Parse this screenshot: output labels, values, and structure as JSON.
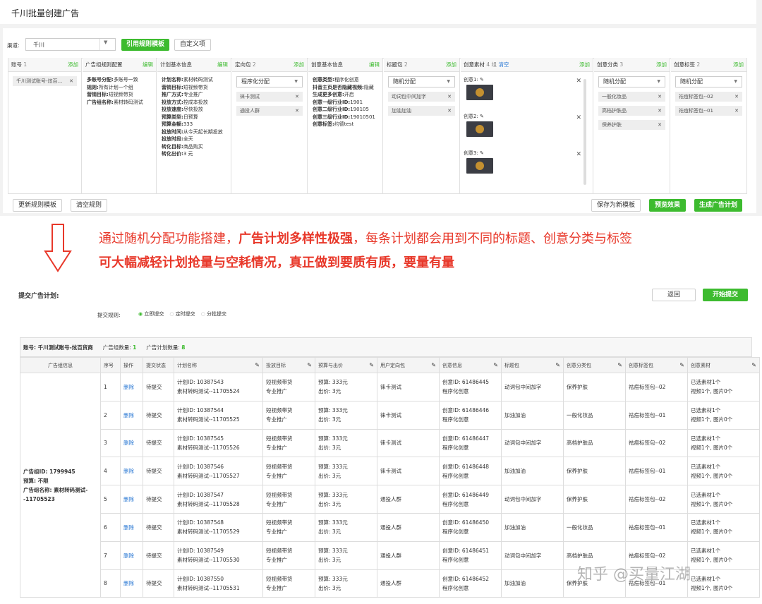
{
  "page_title": "千川批量创建广告",
  "channel": {
    "label": "渠道:",
    "value": "千川",
    "btn_template": "引用规则模板",
    "btn_custom": "自定义项"
  },
  "columns": {
    "account": {
      "title": "账号",
      "count": "1",
      "add": "添加",
      "tag": "千川测试账号-炫百…"
    },
    "group_rule": {
      "title": "广告组规则配置",
      "edit": "编辑",
      "lines": [
        [
          "多账号分配:",
          "多账号一致"
        ],
        [
          "规则:",
          "所有计划一个组"
        ],
        [
          "营销目标:",
          "短视频带货"
        ],
        [
          "广告组名称:",
          "素材转码测试"
        ]
      ]
    },
    "plan_info": {
      "title": "计划基本信息",
      "edit": "编辑",
      "lines": [
        [
          "计划名称:",
          "素材转码测试"
        ],
        [
          "营销目标:",
          "短视频带货"
        ],
        [
          "推广方式:",
          "专业推广"
        ],
        [
          "投放方式:",
          "控成本投放"
        ],
        [
          "投放速度:",
          "尽快投放"
        ],
        [
          "预算类型:",
          "日预算"
        ],
        [
          "预算金额:",
          "333"
        ],
        [
          "投放时间:",
          "从今天起长期投放"
        ],
        [
          "投放时段:",
          "全天"
        ],
        [
          "转化目标:",
          "商品购买"
        ],
        [
          "转化出价:",
          "3 元"
        ]
      ]
    },
    "audience": {
      "title": "定向包",
      "count": "2",
      "add": "添加",
      "select": "程序化分配",
      "tags": [
        "徕卡测试",
        "通投人群"
      ]
    },
    "creative_info": {
      "title": "创意基本信息",
      "edit": "编辑",
      "lines": [
        [
          "创意类型:",
          "程序化创意"
        ],
        [
          "抖音主页是否隐藏视频:",
          "隐藏"
        ],
        [
          "生成更多创意:",
          "开启"
        ],
        [
          "创意一级行业ID:",
          "1901"
        ],
        [
          "创意二级行业ID:",
          "190105"
        ],
        [
          "创意三级行业ID:",
          "19010501"
        ],
        [
          "创意标签:",
          "约德test"
        ]
      ]
    },
    "titles": {
      "title": "标题包",
      "count": "2",
      "add": "添加",
      "select": "随机分配",
      "tags": [
        "动词包中间加字",
        "加油加油"
      ]
    },
    "materials": {
      "title": "创意素材",
      "count": "4 组",
      "clear": "清空",
      "add": "添加",
      "items": [
        "创意1:",
        "创意2:",
        "创意3:"
      ]
    },
    "categories": {
      "title": "创意分类",
      "count": "3",
      "add": "添加",
      "select": "随机分配",
      "tags": [
        "一般化妆品",
        "高档护肤品",
        "保养护肤"
      ]
    },
    "labels": {
      "title": "创意标签",
      "count": "2",
      "add": "添加",
      "select": "随机分配",
      "tags": [
        "祛痘标签包--02",
        "祛痘标签包--01"
      ]
    }
  },
  "footer": {
    "update": "更新规则模板",
    "clear": "清空规则",
    "save": "保存为新模板",
    "preview": "预览效果",
    "generate": "生成广告计划"
  },
  "annotation": {
    "line1a": "通过随机分配功能搭建，",
    "line1b": "广告计划多样性极强",
    "line1c": "，每条计划都会用到不同的标题、创意分类与标签",
    "line2": "可大幅减轻计划抢量与空耗情况，真正做到要质有质，要量有量"
  },
  "submit": {
    "title": "提交广告计划:",
    "back": "返回",
    "start": "开始提交",
    "rule_label": "提交规则:",
    "options": [
      "立即提交",
      "定时提交",
      "分批提交"
    ]
  },
  "summary": {
    "account": "账号: 千川测试账号-炫百货商",
    "group_label": "广告组数量:",
    "group_count": "1",
    "plan_label": "广告计划数量:",
    "plan_count": "8"
  },
  "table": {
    "headers": [
      "广告组信息",
      "序号",
      "操作",
      "提交状态",
      "计划名称",
      "投放目标",
      "预算与出价",
      "用户定向包",
      "创意信息",
      "标题包",
      "创意分类包",
      "创意标签包",
      "创意素材"
    ],
    "group_info": [
      "广告组ID: 1799945",
      "预算: 不限",
      "广告组名称: 素材转码测试--11705523"
    ],
    "rows": [
      {
        "no": "1",
        "op": "删除",
        "status": "待提交",
        "plan1": "计划ID: 10387543",
        "plan2": "素材转码测试--11705524",
        "goal1": "短视频带货",
        "goal2": "专业推广",
        "bud1": "预算: 333元",
        "bud2": "出价: 3元",
        "aud": "徕卡测试",
        "cr1": "创意ID: 61486445",
        "cr2": "程序化创意",
        "title": "动词包中间加字",
        "cat": "保养护肤",
        "lab": "祛痘标签包--02",
        "mat1": "已选素材1个",
        "mat2": "视频1个, 图片0个"
      },
      {
        "no": "2",
        "op": "删除",
        "status": "待提交",
        "plan1": "计划ID: 10387544",
        "plan2": "素材转码测试--11705525",
        "goal1": "短视频带货",
        "goal2": "专业推广",
        "bud1": "预算: 333元",
        "bud2": "出价: 3元",
        "aud": "徕卡测试",
        "cr1": "创意ID: 61486446",
        "cr2": "程序化创意",
        "title": "加油加油",
        "cat": "一般化妆品",
        "lab": "祛痘标签包--01",
        "mat1": "已选素材1个",
        "mat2": "视频1个, 图片0个"
      },
      {
        "no": "3",
        "op": "删除",
        "status": "待提交",
        "plan1": "计划ID: 10387545",
        "plan2": "素材转码测试--11705526",
        "goal1": "短视频带货",
        "goal2": "专业推广",
        "bud1": "预算: 333元",
        "bud2": "出价: 3元",
        "aud": "徕卡测试",
        "cr1": "创意ID: 61486447",
        "cr2": "程序化创意",
        "title": "动词包中间加字",
        "cat": "高档护肤品",
        "lab": "祛痘标签包--02",
        "mat1": "已选素材1个",
        "mat2": "视频1个, 图片0个"
      },
      {
        "no": "4",
        "op": "删除",
        "status": "待提交",
        "plan1": "计划ID: 10387546",
        "plan2": "素材转码测试--11705527",
        "goal1": "短视频带货",
        "goal2": "专业推广",
        "bud1": "预算: 333元",
        "bud2": "出价: 3元",
        "aud": "徕卡测试",
        "cr1": "创意ID: 61486448",
        "cr2": "程序化创意",
        "title": "加油加油",
        "cat": "保养护肤",
        "lab": "祛痘标签包--01",
        "mat1": "已选素材1个",
        "mat2": "视频1个, 图片0个"
      },
      {
        "no": "5",
        "op": "删除",
        "status": "待提交",
        "plan1": "计划ID: 10387547",
        "plan2": "素材转码测试--11705528",
        "goal1": "短视频带货",
        "goal2": "专业推广",
        "bud1": "预算: 333元",
        "bud2": "出价: 3元",
        "aud": "通投人群",
        "cr1": "创意ID: 61486449",
        "cr2": "程序化创意",
        "title": "动词包中间加字",
        "cat": "保养护肤",
        "lab": "祛痘标签包--02",
        "mat1": "已选素材1个",
        "mat2": "视频1个, 图片0个"
      },
      {
        "no": "6",
        "op": "删除",
        "status": "待提交",
        "plan1": "计划ID: 10387548",
        "plan2": "素材转码测试--11705529",
        "goal1": "短视频带货",
        "goal2": "专业推广",
        "bud1": "预算: 333元",
        "bud2": "出价: 3元",
        "aud": "通投人群",
        "cr1": "创意ID: 61486450",
        "cr2": "程序化创意",
        "title": "加油加油",
        "cat": "一般化妆品",
        "lab": "祛痘标签包--01",
        "mat1": "已选素材1个",
        "mat2": "视频1个, 图片0个"
      },
      {
        "no": "7",
        "op": "删除",
        "status": "待提交",
        "plan1": "计划ID: 10387549",
        "plan2": "素材转码测试--11705530",
        "goal1": "短视频带货",
        "goal2": "专业推广",
        "bud1": "预算: 333元",
        "bud2": "出价: 3元",
        "aud": "通投人群",
        "cr1": "创意ID: 61486451",
        "cr2": "程序化创意",
        "title": "动词包中间加字",
        "cat": "高档护肤品",
        "lab": "祛痘标签包--02",
        "mat1": "已选素材1个",
        "mat2": "视频1个, 图片0个"
      },
      {
        "no": "8",
        "op": "删除",
        "status": "待提交",
        "plan1": "计划ID: 10387550",
        "plan2": "素材转码测试--11705531",
        "goal1": "短视频带货",
        "goal2": "专业推广",
        "bud1": "预算: 333元",
        "bud2": "出价: 3元",
        "aud": "通投人群",
        "cr1": "创意ID: 61486452",
        "cr2": "程序化创意",
        "title": "加油加油",
        "cat": "保养护肤",
        "lab": "祛痘标签包--01",
        "mat1": "已选素材1个",
        "mat2": "视频1个, 图片0个"
      }
    ]
  },
  "watermark": "知乎 @买量江湖",
  "colors": {
    "green": "#3dbb2f",
    "red": "#e8382a",
    "link": "#2b79d4"
  }
}
